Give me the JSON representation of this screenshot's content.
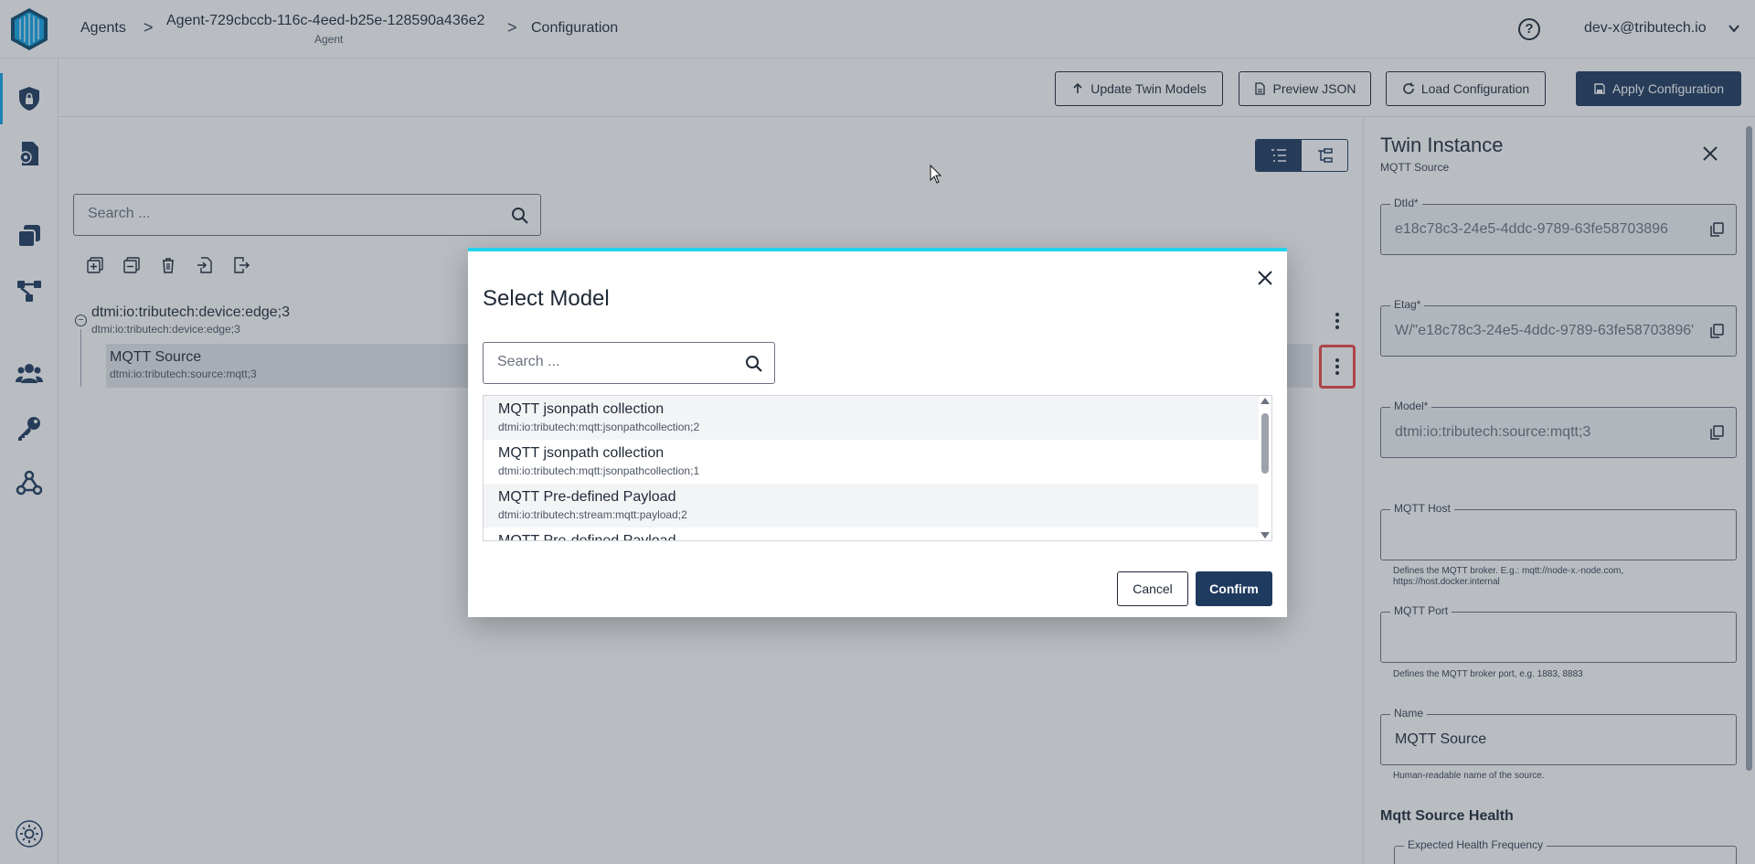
{
  "header": {
    "breadcrumb": [
      {
        "label": "Agents",
        "sub": ""
      },
      {
        "label": "Agent-729cbccb-116c-4eed-b25e-128590a436e2",
        "sub": "Agent"
      },
      {
        "label": "Configuration",
        "sub": ""
      }
    ],
    "separator": ">",
    "help_glyph": "?",
    "user_email": "dev-x@tributech.io"
  },
  "sidebar": {
    "items": [
      {
        "icon": "lock-shield-icon",
        "active": true
      },
      {
        "icon": "document-gear-icon",
        "active": false
      },
      {
        "icon": "layers-icon",
        "active": false
      },
      {
        "icon": "hierarchy-icon",
        "active": false
      },
      {
        "icon": "users-icon",
        "active": false
      },
      {
        "icon": "key-icon",
        "active": false
      },
      {
        "icon": "webhook-icon",
        "active": false
      }
    ],
    "bottom_icon": "sun-icon"
  },
  "toolbar": {
    "update_twin_models": "Update Twin Models",
    "preview_json": "Preview JSON",
    "load_configuration": "Load Configuration",
    "apply_configuration": "Apply Configuration"
  },
  "tree": {
    "search_placeholder": "Search ...",
    "tool_icons": [
      "expand-all-icon",
      "collapse-all-icon",
      "delete-icon",
      "import-icon",
      "export-icon"
    ],
    "root": {
      "title": "dtmi:io:tributech:device:edge;3",
      "sub": "dtmi:io:tributech:device:edge;3",
      "toggle": "−"
    },
    "child": {
      "title": "MQTT Source",
      "sub": "dtmi:io:tributech:source:mqtt;3"
    }
  },
  "twin_panel": {
    "title": "Twin Instance",
    "subtitle": "MQTT Source",
    "fields": {
      "dtid": {
        "label": "DtId*",
        "value": "e18c78c3-24e5-4ddc-9789-63fe58703896"
      },
      "etag": {
        "label": "Etag*",
        "value": "W/\"e18c78c3-24e5-4ddc-9789-63fe58703896\""
      },
      "model": {
        "label": "Model*",
        "value": "dtmi:io:tributech:source:mqtt;3"
      },
      "mqtt_host": {
        "label": "MQTT Host",
        "value": "",
        "help": "Defines the MQTT broker. E.g.: mqtt://node-x.-node.com, https://host.docker.internal"
      },
      "mqtt_port": {
        "label": "MQTT Port",
        "value": "",
        "help": "Defines the MQTT broker port, e.g. 1883, 8883"
      },
      "name": {
        "label": "Name",
        "value": "MQTT Source",
        "help": "Human-readable name of the source."
      }
    },
    "section_title": "Mqtt Source Health",
    "health_field_label": "Expected Health Frequency"
  },
  "modal": {
    "title": "Select Model",
    "search_placeholder": "Search ...",
    "models": [
      {
        "name": "MQTT jsonpath collection",
        "id": "dtmi:io:tributech:mqtt:jsonpathcollection;2"
      },
      {
        "name": "MQTT jsonpath collection",
        "id": "dtmi:io:tributech:mqtt:jsonpathcollection;1"
      },
      {
        "name": "MQTT Pre-defined Payload",
        "id": "dtmi:io:tributech:stream:mqtt:payload;2"
      },
      {
        "name": "MQTT Pre-defined Payload",
        "id": ""
      }
    ],
    "cancel_label": "Cancel",
    "confirm_label": "Confirm",
    "accent_color": "#22d3ee"
  },
  "colors": {
    "primary": "#1e3a5f",
    "accent": "#0ea5e9",
    "highlight": "#ef4444"
  }
}
